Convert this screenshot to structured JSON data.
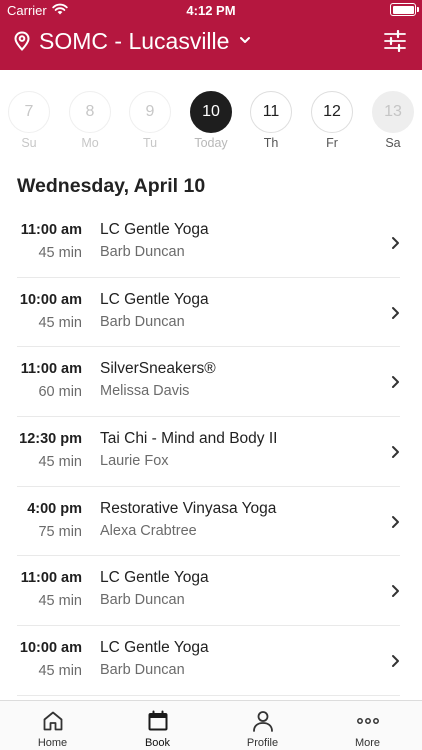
{
  "status_bar": {
    "carrier": "Carrier",
    "time": "4:12 PM"
  },
  "header": {
    "location": "SOMC - Lucasville",
    "accent_color": "#b5173f"
  },
  "days": [
    {
      "number": "7",
      "label": "Su",
      "state": "past"
    },
    {
      "number": "8",
      "label": "Mo",
      "state": "past"
    },
    {
      "number": "9",
      "label": "Tu",
      "state": "past"
    },
    {
      "number": "10",
      "label": "Today",
      "state": "selected"
    },
    {
      "number": "11",
      "label": "Th",
      "state": "future"
    },
    {
      "number": "12",
      "label": "Fr",
      "state": "future"
    },
    {
      "number": "13",
      "label": "Sa",
      "state": "muted"
    }
  ],
  "date_heading": "Wednesday, April 10",
  "classes": [
    {
      "time": "11:00 am",
      "duration": "45 min",
      "name": "LC Gentle Yoga",
      "instructor": "Barb Duncan"
    },
    {
      "time": "10:00 am",
      "duration": "45 min",
      "name": "LC Gentle Yoga",
      "instructor": "Barb Duncan"
    },
    {
      "time": "11:00 am",
      "duration": "60 min",
      "name": "SilverSneakers®",
      "instructor": "Melissa Davis"
    },
    {
      "time": "12:30 pm",
      "duration": "45 min",
      "name": "Tai Chi - Mind and Body II",
      "instructor": "Laurie Fox"
    },
    {
      "time": "4:00 pm",
      "duration": "75 min",
      "name": "Restorative Vinyasa Yoga",
      "instructor": "Alexa Crabtree"
    },
    {
      "time": "11:00 am",
      "duration": "45 min",
      "name": "LC Gentle Yoga",
      "instructor": "Barb Duncan"
    },
    {
      "time": "10:00 am",
      "duration": "45 min",
      "name": "LC Gentle Yoga",
      "instructor": "Barb Duncan"
    }
  ],
  "tabs": [
    {
      "label": "Home",
      "icon": "home-icon"
    },
    {
      "label": "Book",
      "icon": "calendar-icon",
      "active": true
    },
    {
      "label": "Profile",
      "icon": "profile-icon"
    },
    {
      "label": "More",
      "icon": "more-icon"
    }
  ]
}
